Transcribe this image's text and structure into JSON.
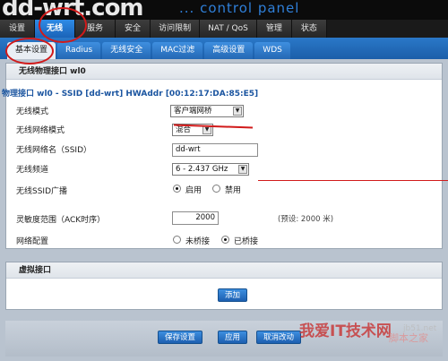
{
  "header": {
    "logo": "dd-wrt.com",
    "subtitle": "... control panel"
  },
  "main_tabs": [
    "设置",
    "无线",
    "服务",
    "安全",
    "访问限制",
    "NAT / QoS",
    "管理",
    "状态"
  ],
  "active_main_tab": "无线",
  "sub_tabs": [
    "基本设置",
    "Radius",
    "无线安全",
    "MAC过滤",
    "高级设置",
    "WDS"
  ],
  "active_sub_tab": "基本设置",
  "section": {
    "title": "无线物理接口 wl0",
    "interface_line": "物理接口 wl0 - SSID [dd-wrt] HWAddr [00:12:17:DA:85:E5]"
  },
  "fields": {
    "mode_label": "无线模式",
    "mode_value": "客户端网桥",
    "network_mode_label": "无线网络模式",
    "network_mode_value": "混合",
    "ssid_label": "无线网络名（SSID）",
    "ssid_value": "dd-wrt",
    "channel_label": "无线频道",
    "channel_value": "6 - 2.437 GHz",
    "ssid_broadcast_label": "无线SSID广播",
    "ssid_broadcast_on": "启用",
    "ssid_broadcast_off": "禁用",
    "sensitivity_label": "灵敏度范围（ACK时序）",
    "sensitivity_value": "2000",
    "sensitivity_hint": "(预设: 2000 米)",
    "network_config_label": "网络配置",
    "unbridged": "未桥接",
    "bridged": "已桥接"
  },
  "virtual": {
    "title": "虚拟接口",
    "add_button": "添加"
  },
  "actions": {
    "save": "保存设置",
    "apply": "应用",
    "cancel": "取消改动"
  },
  "watermark": {
    "main": "我爱IT技术网",
    "sub": "脚本之家",
    "url": "jb51.net"
  },
  "colors": {
    "accent": "#1b5ea9",
    "annotation": "#d11a1a",
    "header_bg": "#0b0b0b"
  }
}
